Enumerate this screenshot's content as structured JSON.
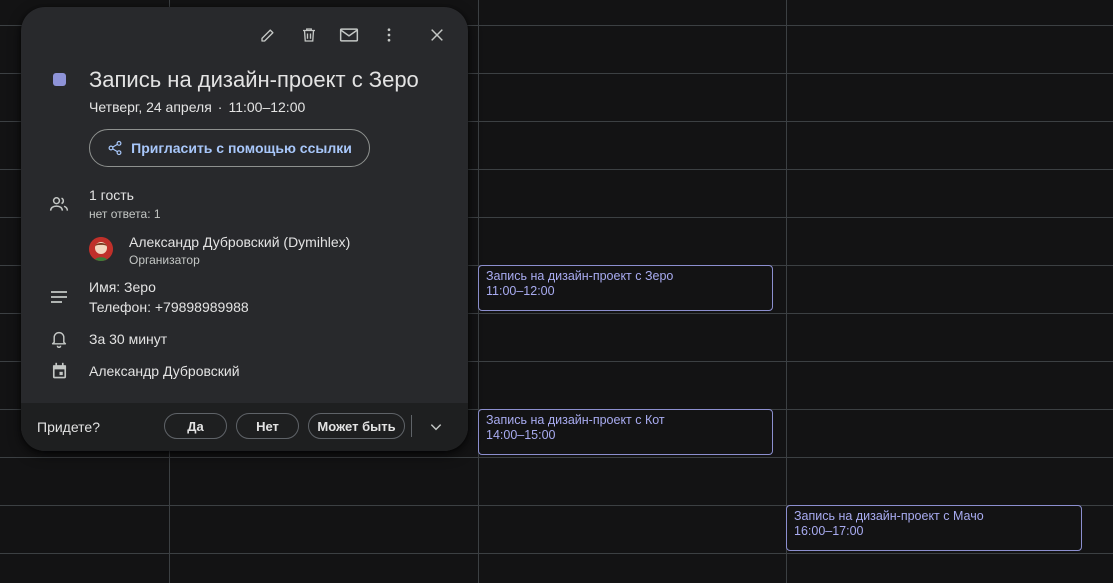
{
  "popup": {
    "title": "Запись на дизайн-проект с Зеро",
    "date": "Четверг, 24 апреля",
    "time": "11:00–12:00",
    "invite_label": "Пригласить с помощью ссылки",
    "guests_count": "1 гость",
    "guests_status": "нет ответа: 1",
    "organizer_name": "Александр Дубровский (Dymihlex)",
    "organizer_role": "Организатор",
    "description_line1": "Имя: Зеро",
    "description_line2": "Телефон: +79898989988",
    "reminder": "За 30 минут",
    "calendar_owner": "Александр Дубровский",
    "color": "#8e93d8",
    "rsvp": {
      "question": "Придете?",
      "yes": "Да",
      "no": "Нет",
      "maybe": "Может быть"
    }
  },
  "events": [
    {
      "title": "Запись на дизайн-проект с Зеро",
      "time": "11:00–12:00"
    },
    {
      "title": "Запись на дизайн-проект с Кот",
      "time": "14:00–15:00"
    },
    {
      "title": "Запись на дизайн-проект с Мачо",
      "time": "16:00–17:00"
    }
  ]
}
